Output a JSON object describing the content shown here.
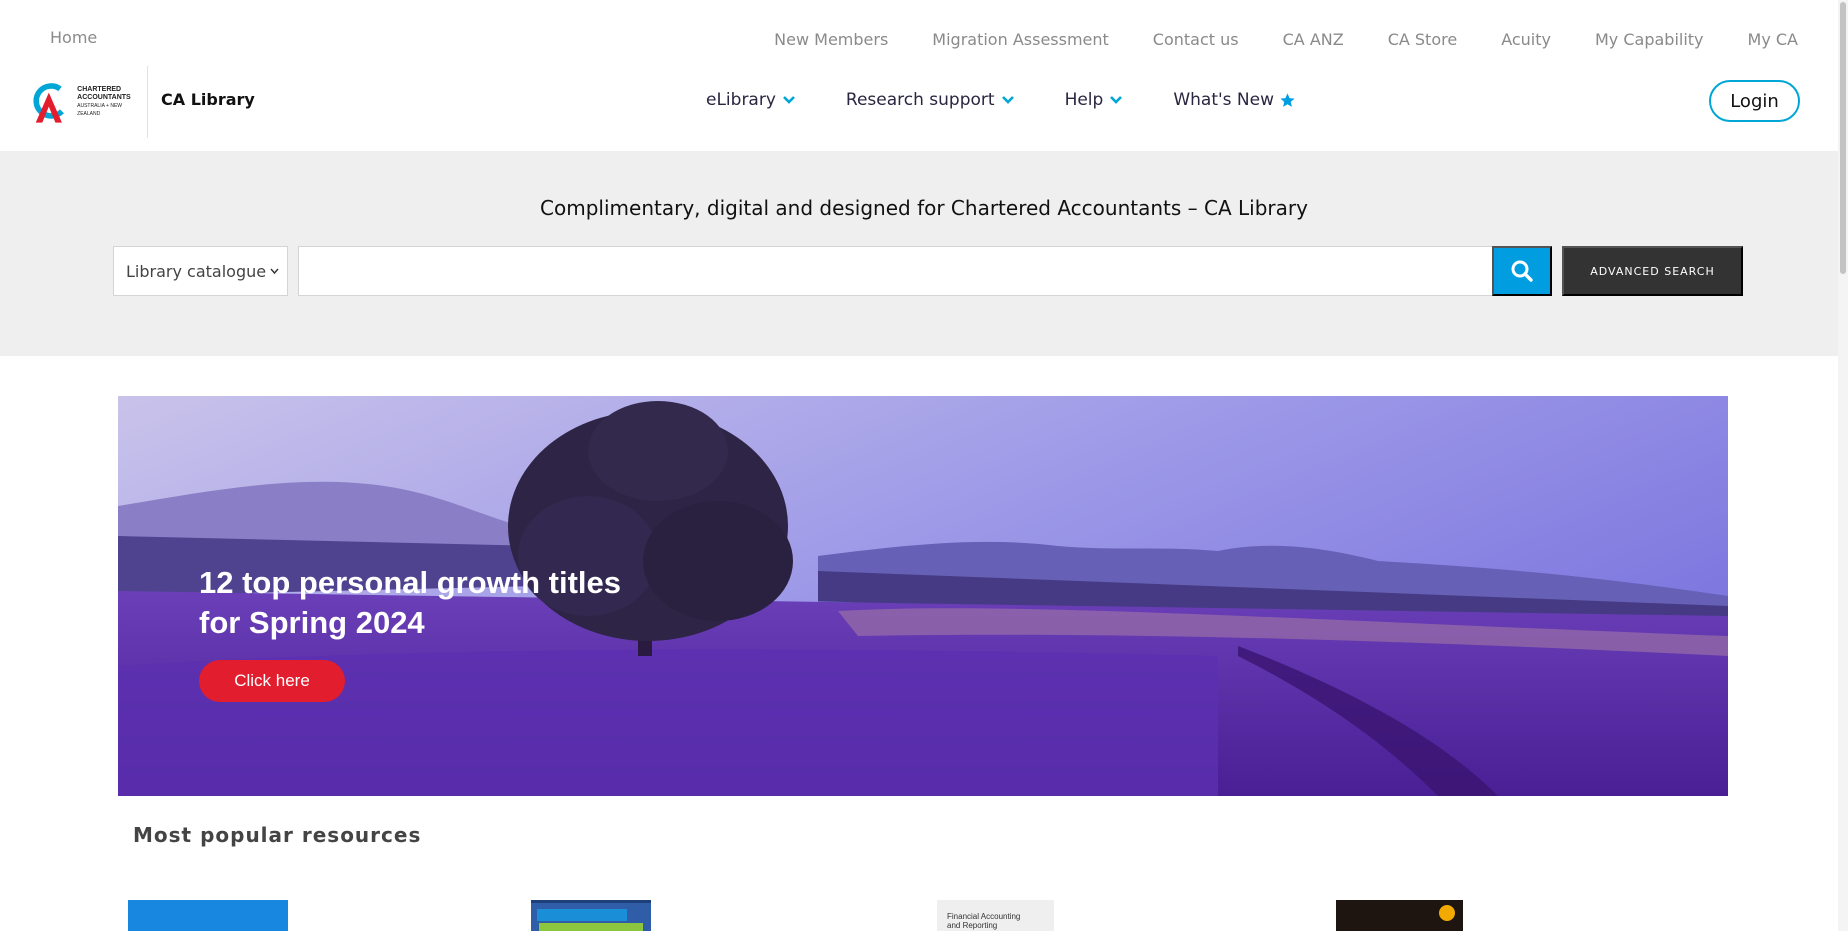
{
  "utility": {
    "home_label": "Home",
    "links": [
      "New Members",
      "Migration Assessment",
      "Contact us",
      "CA ANZ",
      "CA Store",
      "Acuity",
      "My Capability",
      "My CA"
    ]
  },
  "brand": {
    "logo_line1": "CHARTERED",
    "logo_line2": "ACCOUNTANTS",
    "logo_line3": "AUSTRALIA + NEW ZEALAND",
    "product_name": "CA Library",
    "accent_color": "#00a6d6",
    "logo_red": "#e11d2e"
  },
  "main_nav": {
    "elibrary": "eLibrary",
    "research": "Research support",
    "help": "Help",
    "whats_new": "What's New"
  },
  "header": {
    "login_label": "Login"
  },
  "search": {
    "tagline": "Complimentary, digital and designed for Chartered Accountants – CA Library",
    "scope_selected": "Library catalogue",
    "query": "",
    "advanced_label": "ADVANCED SEARCH"
  },
  "hero": {
    "title_line1": "12 top personal growth titles",
    "title_line2": "for Spring 2024",
    "cta_label": "Click here"
  },
  "popular": {
    "title": "Most popular resources",
    "items": [
      {
        "cover_text": ""
      },
      {
        "cover_text": ""
      },
      {
        "cover_text_line1": "Financial Accounting",
        "cover_text_line2": "and Reporting"
      },
      {
        "cover_text": ""
      }
    ]
  }
}
